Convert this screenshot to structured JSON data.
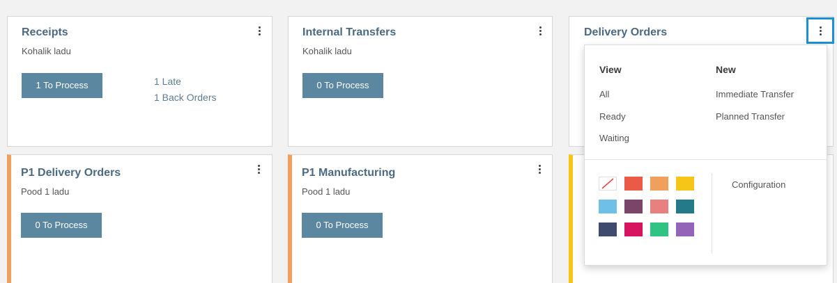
{
  "cards": {
    "receipts": {
      "title": "Receipts",
      "warehouse": "Kohalik ladu",
      "button": "1 To Process",
      "late": "1 Late",
      "back_orders": "1 Back Orders"
    },
    "internal": {
      "title": "Internal Transfers",
      "warehouse": "Kohalik ladu",
      "button": "0 To Process"
    },
    "delivery": {
      "title": "Delivery Orders"
    },
    "p1_delivery": {
      "title": "P1 Delivery Orders",
      "warehouse": "Pood 1 ladu",
      "button": "0 To Process",
      "accent": "#f0a05c"
    },
    "p1_manufacturing": {
      "title": "P1 Manufacturing",
      "warehouse": "Pood 1 ladu",
      "button": "0 To Process",
      "accent": "#f0a05c"
    },
    "third_row_card": {
      "accent": "#f5c518"
    }
  },
  "menu": {
    "view_heading": "View",
    "view_items": [
      "All",
      "Ready",
      "Waiting"
    ],
    "new_heading": "New",
    "new_items": [
      "Immediate Transfer",
      "Planned Transfer"
    ],
    "configuration": "Configuration",
    "color_swatches": [
      "none",
      "#eb5a46",
      "#f0a05c",
      "#f5c518",
      "#6ec0e8",
      "#7a4568",
      "#e88080",
      "#257a8a",
      "#3e4b6e",
      "#d6145f",
      "#30c381",
      "#9365b8"
    ]
  },
  "colors": {
    "title": "#4b6a82",
    "button": "#5b87a0",
    "highlight": "#1b8fd8"
  }
}
